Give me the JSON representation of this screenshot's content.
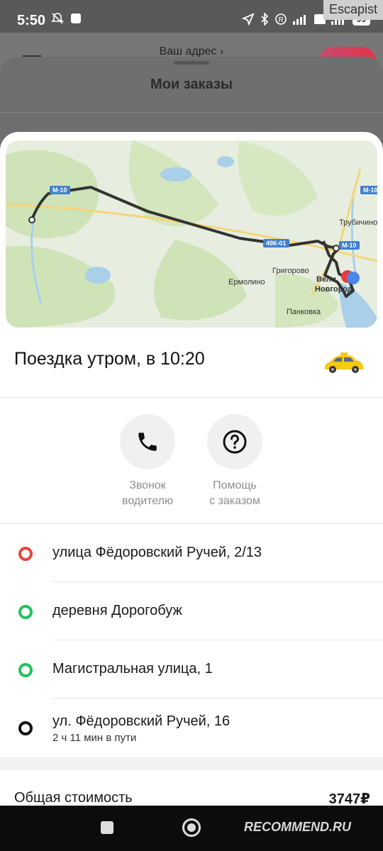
{
  "status_bar": {
    "time": "5:50",
    "battery": "99",
    "watermark": "Escapist"
  },
  "underlying": {
    "address_label": "Ваш адрес ›"
  },
  "orders_sheet": {
    "title": "Мои заказы"
  },
  "map": {
    "labels": {
      "trubichino": "Трубичино",
      "grigorovo": "Григорово",
      "ermolino": "Ермолино",
      "velikiy": "Вели",
      "novgorod": "Новгород",
      "pankovka": "Панковка"
    },
    "shields": {
      "m10_top": "М-10",
      "m10_right": "М-10",
      "r_road": "49К-01"
    }
  },
  "trip": {
    "title": "Поездка утром, в 10:20",
    "car_icon": "taxi-car-icon"
  },
  "actions": {
    "call_label_line1": "Звонок",
    "call_label_line2": "водителю",
    "help_label_line1": "Помощь",
    "help_label_line2": "с заказом"
  },
  "route": {
    "points": [
      {
        "address": "улица Фёдоровский Ручей, 2/13",
        "color": "#e8443a"
      },
      {
        "address": "деревня Дорогобуж",
        "color": "#21c35a"
      },
      {
        "address": "Магистральная улица, 1",
        "color": "#21c35a"
      },
      {
        "address": "ул. Фёдоровский Ручей, 16",
        "subtitle": "2 ч 11 мин в пути",
        "color": "#111111"
      }
    ]
  },
  "total": {
    "label": "Общая стоимость",
    "value": "3747₽"
  },
  "nav": {
    "watermark": "RECOMMEND.RU"
  }
}
